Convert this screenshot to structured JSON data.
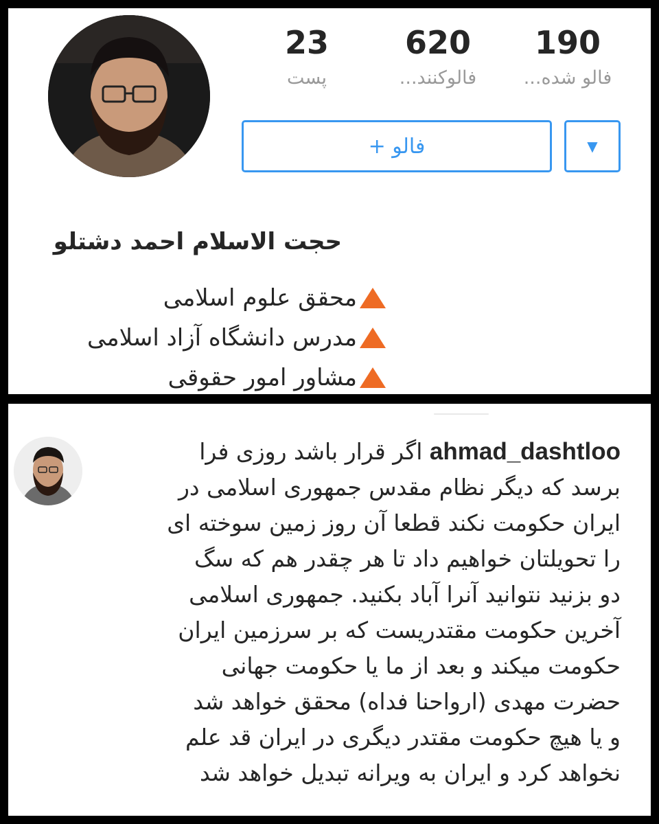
{
  "profile": {
    "stats": [
      {
        "value": "23",
        "label": "پست"
      },
      {
        "value": "620",
        "label": "فالوکنند..."
      },
      {
        "value": "190",
        "label": "فالو شده..."
      }
    ],
    "follow_button": "فالو +",
    "dropdown_icon": "caret-down-icon",
    "name": "حجت الاسلام احمد دشتلو",
    "bio": [
      "محقق علوم اسلامی",
      "مدرس دانشگاه آزاد اسلامی",
      "مشاور امور حقوقی"
    ],
    "bio_marker_color": "#ee6b24",
    "accent_color": "#3897f0"
  },
  "comment": {
    "username": "ahmad_dashtloo",
    "lines": [
      "اگر قرار باشد روزی فرا",
      "برسد که دیگر نظام مقدس جمهوری اسلامی در",
      "ایران حکومت نکند قطعا آن روز زمین سوخته ای",
      "را تحویلتان خواهیم داد تا هر چقدر هم که سگ",
      "دو بزنید نتوانید آنرا آباد بکنید. جمهوری اسلامی",
      "آخرین حکومت مقتدریست که بر سرزمین ایران",
      "حکومت میکند و بعد از ما یا حکومت جهانی",
      "حضرت مهدی (ارواحنا فداه) محقق خواهد شد",
      "و یا هیچ حکومت مقتدر دیگری در ایران قد علم",
      "نخواهد کرد و ایران به ویرانه تبدیل خواهد شد"
    ]
  }
}
